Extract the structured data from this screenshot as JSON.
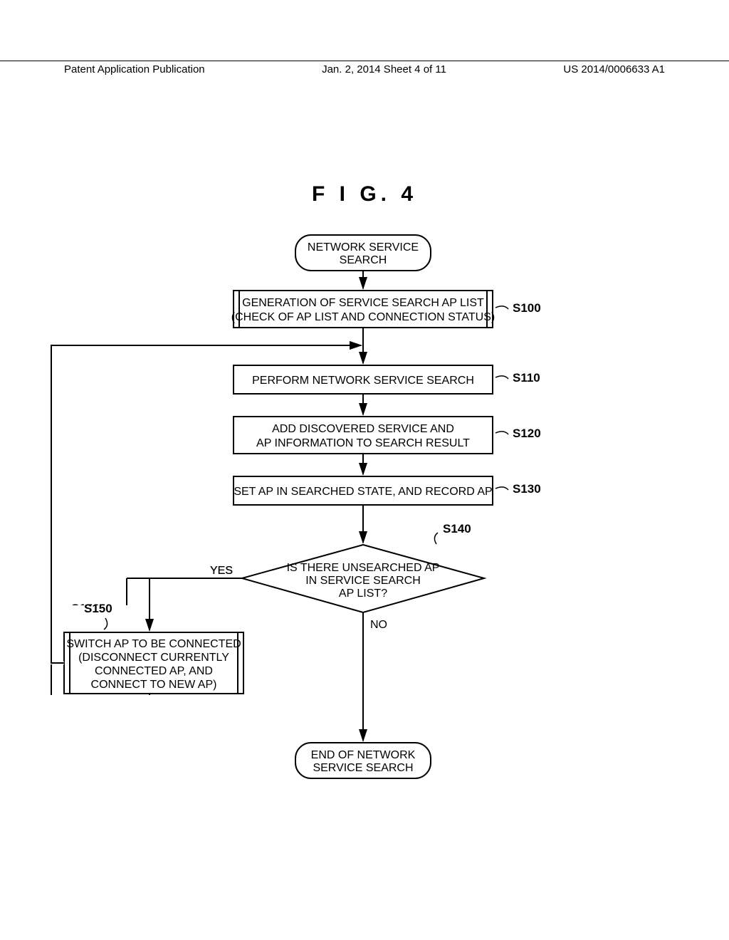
{
  "header": {
    "left": "Patent Application Publication",
    "center": "Jan. 2, 2014   Sheet 4 of 11",
    "right": "US 2014/0006633 A1"
  },
  "figure_title": "F I G.  4",
  "nodes": {
    "start": {
      "line1": "NETWORK SERVICE",
      "line2": "SEARCH"
    },
    "s100": {
      "line1": "GENERATION OF SERVICE SEARCH AP LIST",
      "line2": "(CHECK OF AP LIST AND CONNECTION STATUS)",
      "label": "S100"
    },
    "s110": {
      "line1": "PERFORM NETWORK SERVICE SEARCH",
      "label": "S110"
    },
    "s120": {
      "line1": "ADD DISCOVERED SERVICE AND",
      "line2": "AP INFORMATION TO SEARCH RESULT",
      "label": "S120"
    },
    "s130": {
      "line1": "SET AP IN SEARCHED STATE, AND RECORD AP",
      "label": "S130"
    },
    "s140": {
      "line1": "IS THERE UNSEARCHED AP",
      "line2": "IN SERVICE SEARCH",
      "line3": "AP LIST?",
      "label": "S140"
    },
    "s150": {
      "line1": "SWITCH AP TO BE CONNECTED",
      "line2": "(DISCONNECT CURRENTLY",
      "line3": "CONNECTED AP, AND",
      "line4": "CONNECT TO NEW AP)",
      "label": "S150"
    },
    "end": {
      "line1": "END OF NETWORK",
      "line2": "SERVICE SEARCH"
    }
  },
  "edges": {
    "yes": "YES",
    "no": "NO"
  }
}
